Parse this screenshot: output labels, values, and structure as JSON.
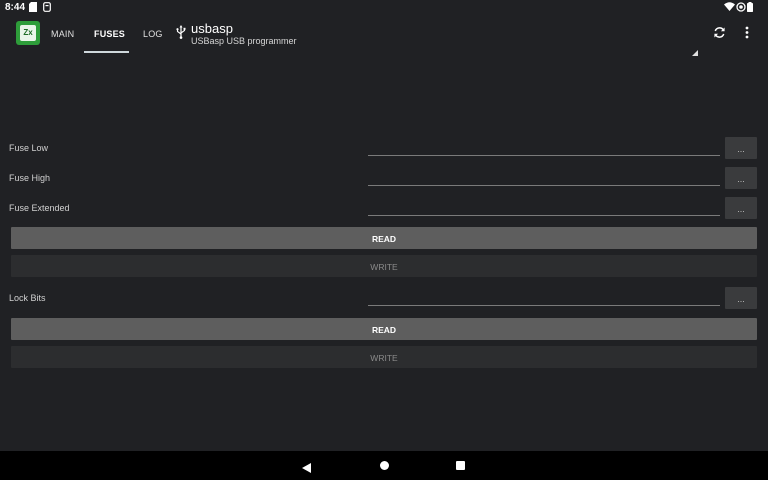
{
  "status_bar": {
    "time": "8:44"
  },
  "app": {
    "logo_text": "Zx"
  },
  "tabs": [
    {
      "label": "MAIN"
    },
    {
      "label": "FUSES"
    },
    {
      "label": "LOG"
    }
  ],
  "device": {
    "name": "usbasp",
    "description": "USBasp USB programmer"
  },
  "fuses": {
    "rows": [
      {
        "label": "Fuse Low",
        "value": "",
        "button": "..."
      },
      {
        "label": "Fuse High",
        "value": "",
        "button": "..."
      },
      {
        "label": "Fuse Extended",
        "value": "",
        "button": "..."
      }
    ],
    "read_label": "READ",
    "write_label": "WRITE"
  },
  "lock": {
    "label": "Lock Bits",
    "value": "",
    "button": "...",
    "read_label": "READ",
    "write_label": "WRITE"
  },
  "icons": {
    "status_left": [
      "sim-card-icon",
      "sd-card-icon"
    ],
    "status_right": [
      "wifi-icon",
      "brightness-icon",
      "battery-icon"
    ],
    "toolbar": [
      "usb-icon",
      "refresh-icon",
      "more-vert-icon"
    ],
    "nav": [
      "back-icon",
      "home-icon",
      "recents-icon"
    ]
  }
}
